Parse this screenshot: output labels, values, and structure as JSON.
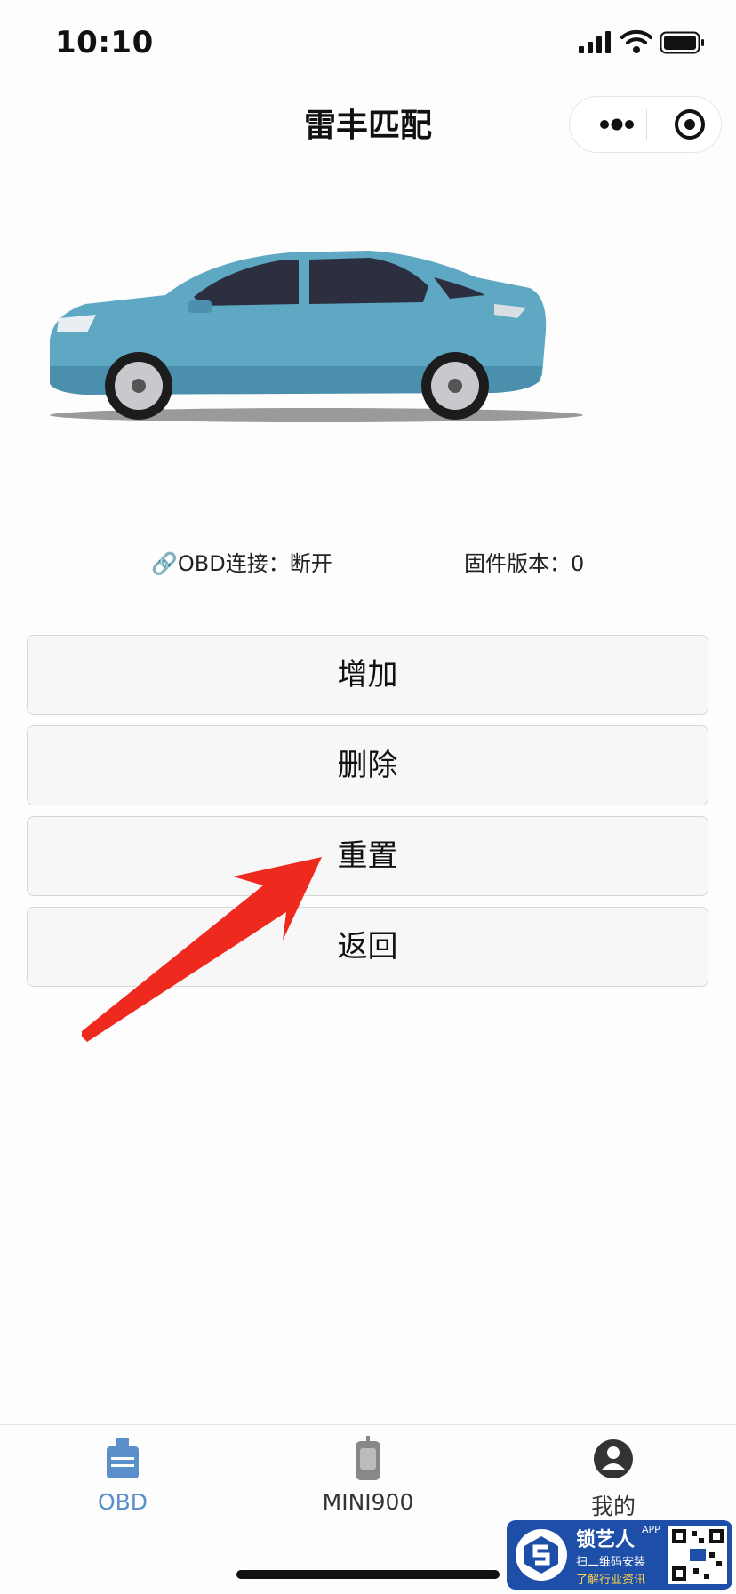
{
  "status_bar": {
    "time": "10:10"
  },
  "nav": {
    "title": "雷丰匹配"
  },
  "info": {
    "obd_label": "🔗OBD连接：断开",
    "firmware_label": "固件版本：0"
  },
  "buttons": {
    "add": "增加",
    "delete": "删除",
    "reset": "重置",
    "back": "返回"
  },
  "tabbar": {
    "items": [
      {
        "label": "OBD",
        "icon": "obd-icon",
        "active": true
      },
      {
        "label": "MINI900",
        "icon": "device-icon",
        "active": false
      },
      {
        "label": "我的",
        "icon": "user-icon",
        "active": false
      }
    ]
  },
  "watermark": {
    "brand": "锁艺人",
    "app": "APP",
    "line1": "扫二维码安装",
    "line2": "了解行业资讯"
  },
  "colors": {
    "accent": "#5b8fc9",
    "arrow": "#ee2a1f",
    "car_body": "#5fa8c3"
  }
}
